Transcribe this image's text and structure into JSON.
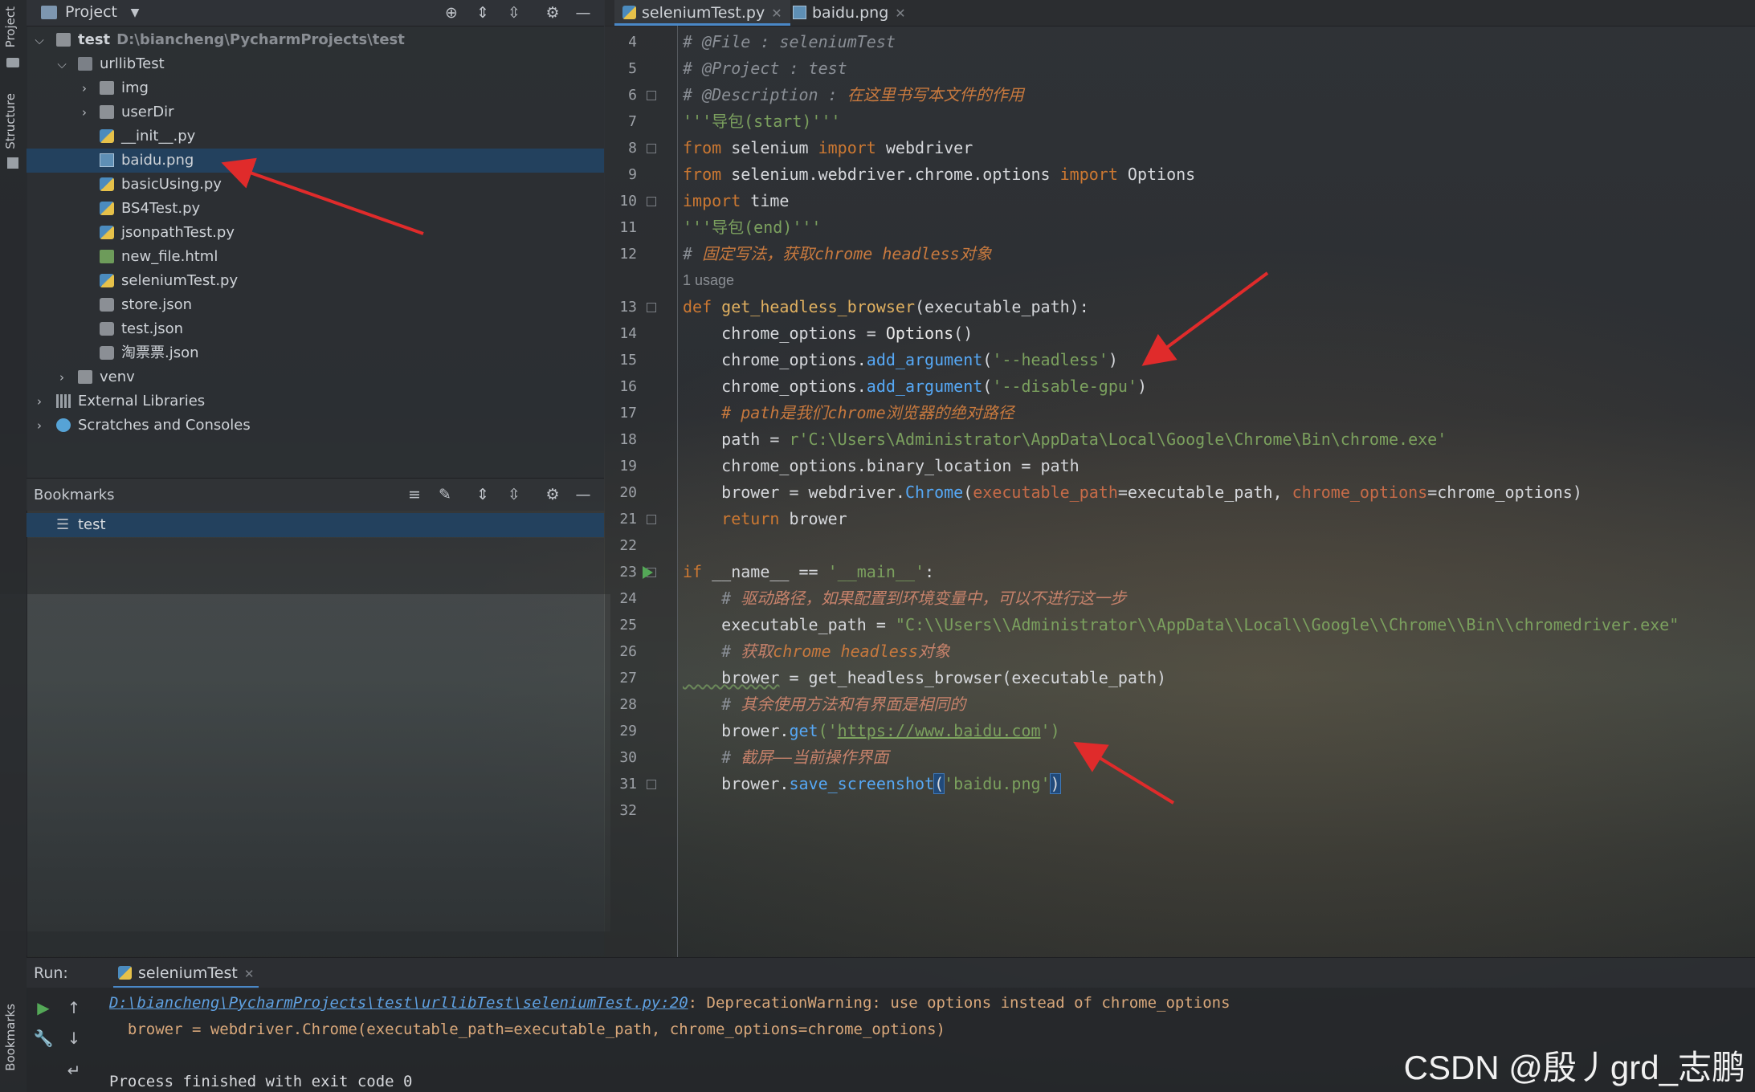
{
  "tool_strip": {
    "project": "Project",
    "structure": "Structure",
    "bookmarks": "Bookmarks"
  },
  "project_panel": {
    "title": "Project",
    "tree": [
      {
        "label": "test",
        "path": "D:\\biancheng\\PycharmProjects\\test",
        "icon": "folder-icon"
      },
      {
        "label": "urllibTest",
        "icon": "folder-icon"
      },
      {
        "label": "img",
        "icon": "folder-icon"
      },
      {
        "label": "userDir",
        "icon": "folder-icon"
      },
      {
        "label": "__init__.py",
        "icon": "python-file-icon"
      },
      {
        "label": "baidu.png",
        "icon": "image-file-icon",
        "selected": true
      },
      {
        "label": "basicUsing.py",
        "icon": "python-file-icon"
      },
      {
        "label": "BS4Test.py",
        "icon": "python-file-icon"
      },
      {
        "label": "jsonpathTest.py",
        "icon": "python-file-icon"
      },
      {
        "label": "new_file.html",
        "icon": "html-file-icon"
      },
      {
        "label": "seleniumTest.py",
        "icon": "python-file-icon"
      },
      {
        "label": "store.json",
        "icon": "json-file-icon"
      },
      {
        "label": "test.json",
        "icon": "json-file-icon"
      },
      {
        "label": "淘票票.json",
        "icon": "json-file-icon"
      },
      {
        "label": "venv",
        "icon": "folder-icon"
      },
      {
        "label": "External Libraries",
        "icon": "library-icon"
      },
      {
        "label": "Scratches and Consoles",
        "icon": "scratches-icon"
      }
    ]
  },
  "bookmarks_panel": {
    "title": "Bookmarks",
    "item": "test"
  },
  "editor": {
    "tabs": [
      {
        "label": "seleniumTest.py",
        "active": true
      },
      {
        "label": "baidu.png",
        "active": false
      }
    ],
    "line_numbers": [
      "4",
      "5",
      "6",
      "7",
      "8",
      "9",
      "10",
      "11",
      "12",
      "",
      "13",
      "14",
      "15",
      "16",
      "17",
      "18",
      "19",
      "20",
      "21",
      "22",
      "23",
      "24",
      "25",
      "26",
      "27",
      "28",
      "29",
      "30",
      "31",
      "32"
    ],
    "usage_hint": "1 usage",
    "code": {
      "l4": "# @File : seleniumTest",
      "l5": "# @Project : test",
      "l6a": "# @Description : ",
      "l6b": "在这里书写本文件的作用",
      "l7a": "'''",
      "l7b": "导包",
      "l7c": "(start)'''",
      "l8a": "from",
      "l8b": " selenium ",
      "l8c": "import",
      "l8d": " webdriver",
      "l9a": "from",
      "l9b": " selenium.webdriver.chrome.options ",
      "l9c": "import",
      "l9d": " Options",
      "l10a": "import",
      "l10b": " time",
      "l11a": "'''",
      "l11b": "导包",
      "l11c": "(end)'''",
      "l12a": "# ",
      "l12b": "固定写法，获取",
      "l12c": "chrome headless",
      "l12d": "对象",
      "l13a": "def",
      "l13b": " get_headless_browser",
      "l13c": "(executable_path):",
      "l14a": "    chrome_options = ",
      "l14b": "Options",
      "l14c": "()",
      "l15a": "    chrome_options.",
      "l15b": "add_argument",
      "l15c": "(",
      "l15d": "'--headless'",
      "l15e": ")",
      "l16a": "    chrome_options.",
      "l16b": "add_argument",
      "l16c": "(",
      "l16d": "'--disable-gpu'",
      "l16e": ")",
      "l17a": "    # path",
      "l17b": "是我们",
      "l17c": "chrome",
      "l17d": "浏览器的绝对路径",
      "l18a": "    path = ",
      "l18b": "r'C:\\Users\\Administrator\\AppData\\Local\\Google\\Chrome\\Bin\\chrome.exe'",
      "l19a": "    chrome_options.binary_location = path",
      "l20a": "    brower = webdriver.",
      "l20b": "Chrome",
      "l20c": "(",
      "l20d": "executable_path",
      "l20e": "=executable_path, ",
      "l20f": "chrome_options",
      "l20g": "=chrome_options)",
      "l21a": "    return",
      "l21b": " brower",
      "l23a": "if",
      "l23b": " __name__ == ",
      "l23c": "'__main__'",
      "l23d": ":",
      "l24a": "    # ",
      "l24b": "驱动路径，如果配置到环境变量中，可以不进行这一步",
      "l25a": "    executable_path = ",
      "l25b": "\"C:\\\\Users\\\\Administrator\\\\AppData\\\\Local\\\\Google\\\\Chrome\\\\Bin\\\\chromedriver.exe\"",
      "l26a": "    # ",
      "l26b": "获取",
      "l26c": "chrome headless",
      "l26d": "对象",
      "l27a": "    brower",
      "l27b": " = get_headless_browser(executable_path)",
      "l28a": "    # ",
      "l28b": "其余使用方法和有界面是相同的",
      "l29a": "    brower.",
      "l29b": "get",
      "l29c": "('",
      "l29d": "https://www.baidu.com",
      "l29e": "')",
      "l30a": "    # ",
      "l30b": "截屏——当前操作界面",
      "l31a": "    brower.",
      "l31b": "save_screenshot",
      "l31c": "(",
      "l31d": "'baidu.png'",
      "l31e": ")"
    }
  },
  "run_panel": {
    "label": "Run:",
    "tab": "seleniumTest",
    "output": {
      "link": "D:\\biancheng\\PycharmProjects\\test\\urllibTest\\seleniumTest.py:20",
      "warning": ": DeprecationWarning: use options instead of chrome_options",
      "line2": "  brower = webdriver.Chrome(executable_path=executable_path, chrome_options=chrome_options)",
      "line3": "Process finished with exit code 0"
    }
  },
  "watermark": "CSDN @殷丿grd_志鹏",
  "colors": {
    "accent": "#4a88c7",
    "selection": "#23415e",
    "annotation_arrow": "#e02b2b"
  }
}
